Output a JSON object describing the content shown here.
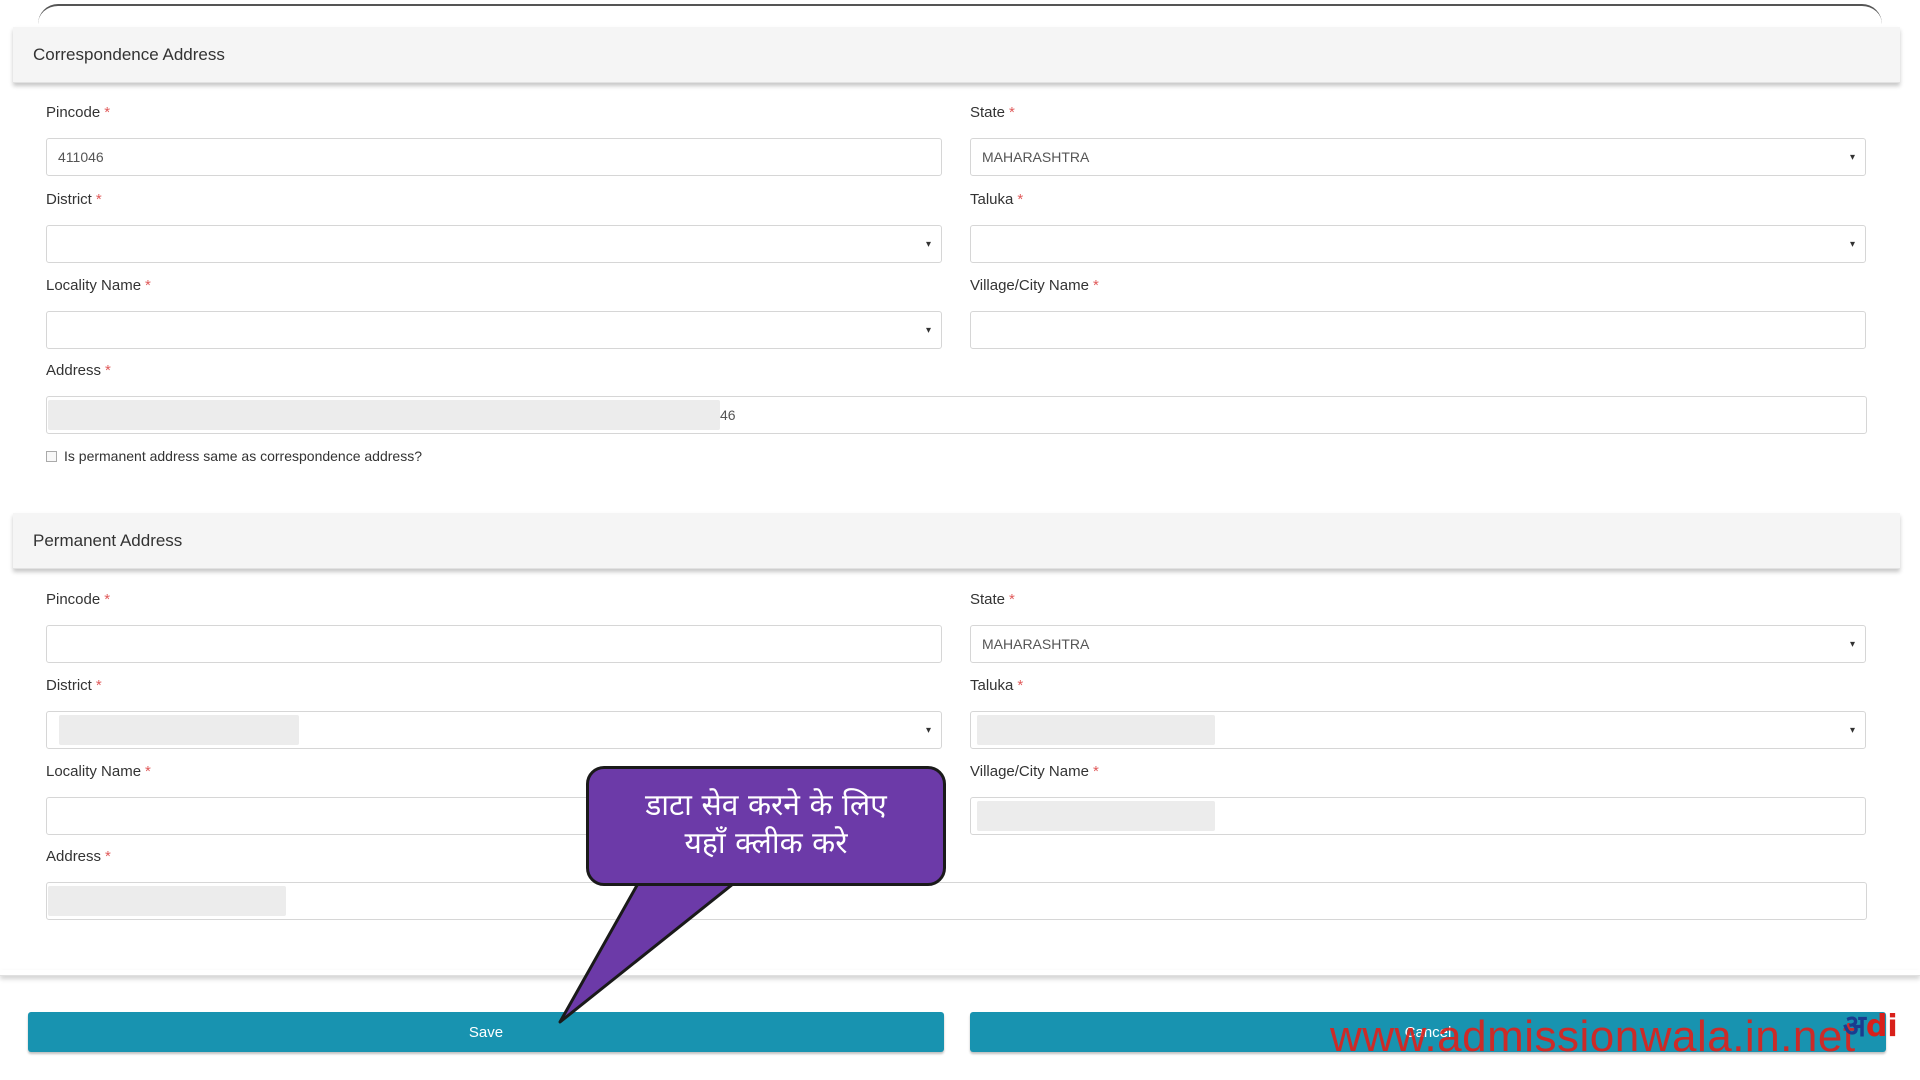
{
  "correspondence": {
    "title": "Correspondence Address",
    "pincode_label": "Pincode",
    "pincode_value": "411046",
    "state_label": "State",
    "state_value": "MAHARASHTRA",
    "district_label": "District",
    "taluka_label": "Taluka",
    "locality_label": "Locality Name",
    "village_label": "Village/City Name",
    "address_label": "Address",
    "address_value": "46",
    "same_address_label": "Is permanent address same as correspondence address?"
  },
  "permanent": {
    "title": "Permanent Address",
    "pincode_label": "Pincode",
    "state_label": "State",
    "state_value": "MAHARASHTRA",
    "district_label": "District",
    "taluka_label": "Taluka",
    "locality_label": "Locality Name",
    "village_label": "Village/City Name",
    "address_label": "Address"
  },
  "required_marker": "*",
  "caret_glyph": "▾",
  "buttons": {
    "save_label": "Save",
    "cancel_label": "Cancel"
  },
  "callout": {
    "line1": "डाटा सेव करने के लिए",
    "line2": "यहाँ क्लीक करे"
  },
  "watermark": {
    "text": "www.admissionwala.in.net",
    "logo_text_main": "अ",
    "logo_text_accent": "di"
  },
  "colors": {
    "button": "#1893b0",
    "callout": "#6c3aa8",
    "required": "#e05a5a",
    "watermark": "#e0201a"
  }
}
